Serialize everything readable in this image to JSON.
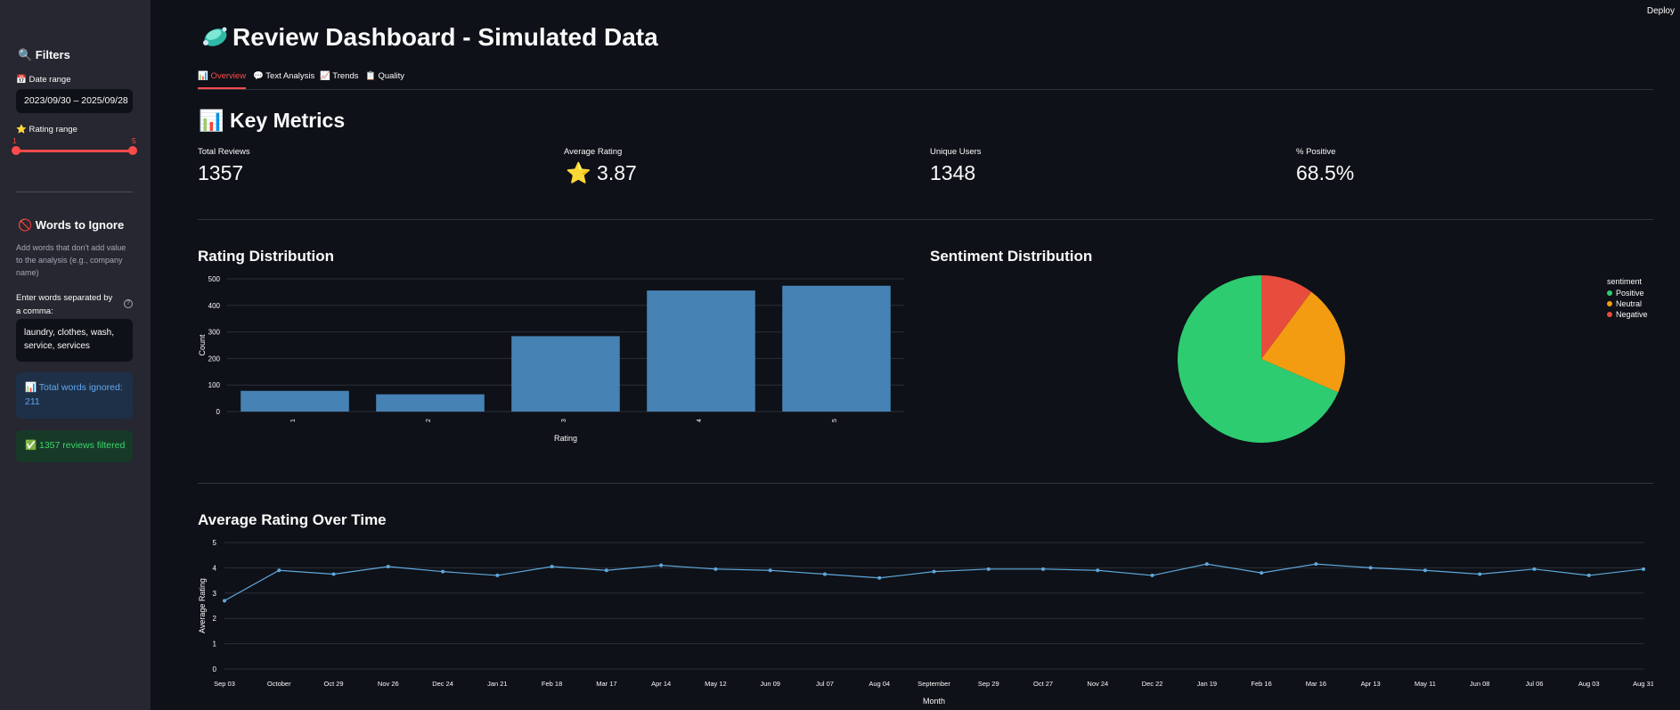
{
  "sidebar": {
    "filters_title": "🔍 Filters",
    "date_range_label": "📅 Date range",
    "date_range_value": "2023/09/30 – 2025/09/28",
    "rating_range_label": "⭐ Rating range",
    "rating_min": "1",
    "rating_max": "5",
    "words_title": "🚫 Words to Ignore",
    "words_help": "Add words that don't add value to the analysis (e.g., company name)",
    "words_input_label": "Enter words separated by a comma:",
    "words_input_value": "laundry, clothes, wash, service, services",
    "help_glyph": "?",
    "info_text": "📊 Total words ignored: 211",
    "success_text": "✅ 1357 reviews filtered"
  },
  "header": {
    "deploy_label": "Deploy",
    "title": "Review Dashboard - Simulated Data",
    "title_icon": "soap-icon"
  },
  "tabs": [
    {
      "label": "📊 Overview",
      "active": true
    },
    {
      "label": "💬 Text Analysis",
      "active": false
    },
    {
      "label": "📈 Trends",
      "active": false
    },
    {
      "label": "📋 Quality",
      "active": false
    }
  ],
  "key_metrics": {
    "title": "📊 Key Metrics",
    "items": [
      {
        "label": "Total Reviews",
        "value": "1357"
      },
      {
        "label": "Average Rating",
        "value": "⭐ 3.87"
      },
      {
        "label": "Unique Users",
        "value": "1348"
      },
      {
        "label": "% Positive",
        "value": "68.5%"
      }
    ]
  },
  "colors": {
    "bar": "#4682b4",
    "positive": "#2ecc71",
    "neutral": "#f39c12",
    "negative": "#e74c3c",
    "line": "#5fa8dc",
    "accent": "#ff4b4b"
  },
  "chart_data": [
    {
      "type": "bar",
      "title": "Rating Distribution",
      "xlabel": "Rating",
      "ylabel": "Count",
      "categories": [
        "1",
        "2",
        "3",
        "4",
        "5"
      ],
      "values": [
        78,
        65,
        284,
        456,
        474
      ],
      "ylim": [
        0,
        500
      ],
      "yticks": [
        0,
        100,
        200,
        300,
        400,
        500
      ],
      "grid": true
    },
    {
      "type": "pie",
      "title": "Sentiment Distribution",
      "legend_title": "sentiment",
      "legend_position": "top-right",
      "labels": [
        "Positive",
        "Neutral",
        "Negative"
      ],
      "values": [
        68.5,
        21.3,
        10.2
      ]
    },
    {
      "type": "line",
      "title": "Average Rating Over Time",
      "xlabel": "Month",
      "ylabel": "Average Rating",
      "ylim": [
        0,
        5
      ],
      "yticks": [
        0,
        1,
        2,
        3,
        4,
        5
      ],
      "x_tick_labels": [
        "Sep 03",
        "October",
        "Oct 29",
        "Nov 26",
        "Dec 24",
        "Jan 21",
        "Feb 18",
        "Mar 17",
        "Apr 14",
        "May 12",
        "Jun 09",
        "Jul 07",
        "Aug 04",
        "September",
        "Sep 29",
        "Oct 27",
        "Nov 24",
        "Dec 22",
        "Jan 19",
        "Feb 16",
        "Mar 16",
        "Apr 13",
        "May 11",
        "Jun 08",
        "Jul 06",
        "Aug 03",
        "Aug 31"
      ],
      "series": [
        {
          "values": [
            2.7,
            3.9,
            3.75,
            4.05,
            3.85,
            3.7,
            4.05,
            3.9,
            4.1,
            3.95,
            3.9,
            3.75,
            3.6,
            3.85,
            3.95,
            3.95,
            3.9,
            3.7,
            4.15,
            3.8,
            4.15,
            4.0,
            3.9,
            3.75,
            3.95,
            3.7,
            3.95
          ]
        }
      ],
      "grid": true
    }
  ]
}
